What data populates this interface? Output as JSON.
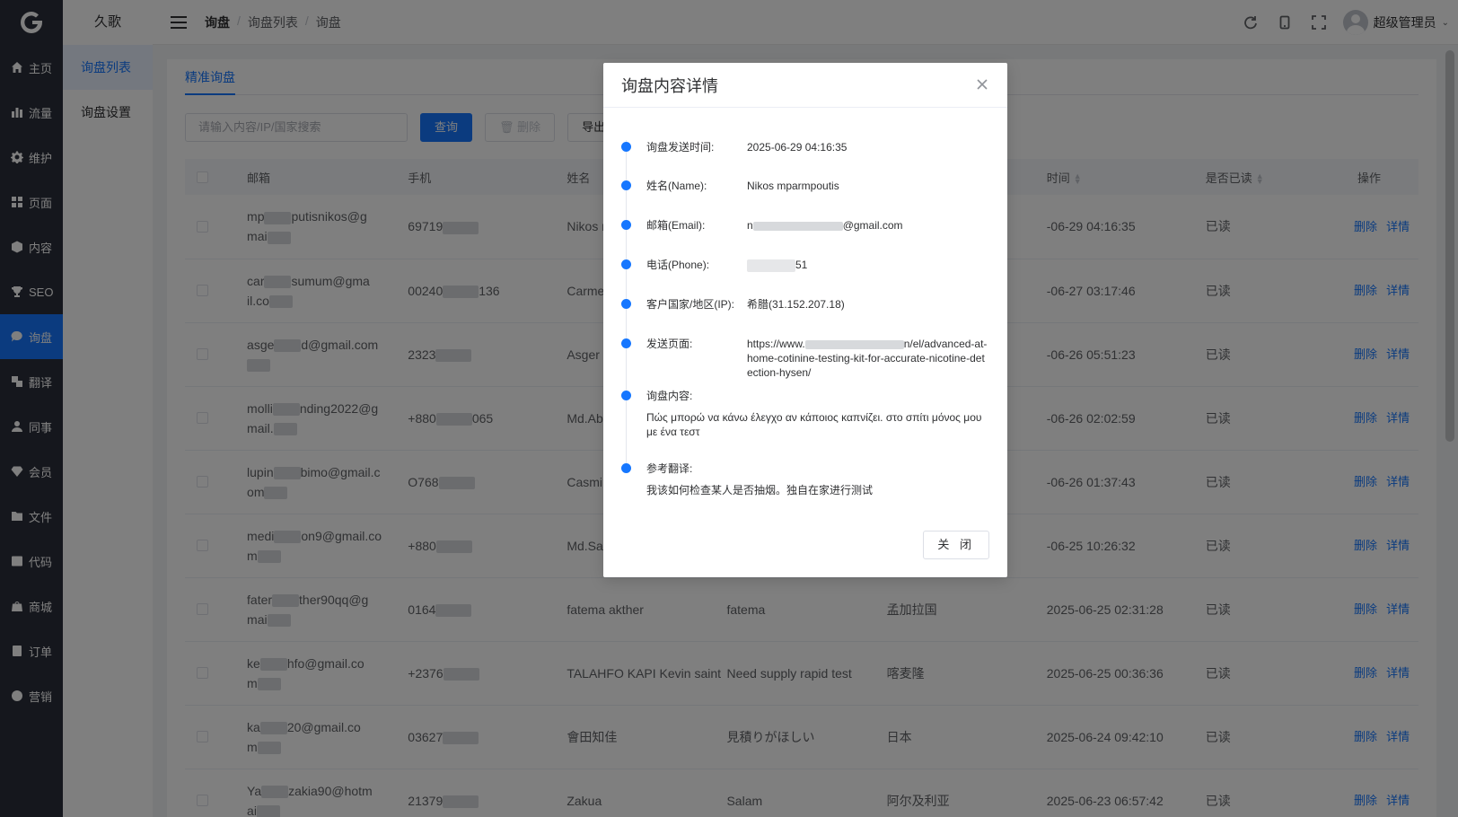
{
  "brand": {
    "logo_icon": "g-logo-icon",
    "app_name": "久歌"
  },
  "nav": [
    {
      "label": "主页",
      "icon": "home-icon"
    },
    {
      "label": "流量",
      "icon": "bar-chart-icon"
    },
    {
      "label": "维护",
      "icon": "gear-icon"
    },
    {
      "label": "页面",
      "icon": "grid-icon"
    },
    {
      "label": "内容",
      "icon": "cube-icon"
    },
    {
      "label": "SEO",
      "icon": "trophy-icon"
    },
    {
      "label": "询盘",
      "icon": "chat-icon",
      "active": true
    },
    {
      "label": "翻译",
      "icon": "translate-icon"
    },
    {
      "label": "同事",
      "icon": "user-icon"
    },
    {
      "label": "会员",
      "icon": "diamond-icon"
    },
    {
      "label": "文件",
      "icon": "folder-icon"
    },
    {
      "label": "代码",
      "icon": "code-icon"
    },
    {
      "label": "商城",
      "icon": "bag-icon"
    },
    {
      "label": "订单",
      "icon": "order-icon"
    },
    {
      "label": "营销",
      "icon": "snowflake-icon"
    }
  ],
  "subnav": {
    "items": [
      "询盘列表",
      "询盘设置"
    ],
    "active": 0
  },
  "header": {
    "breadcrumb": [
      "询盘",
      "询盘列表",
      "询盘"
    ],
    "separator": "/",
    "icons": [
      "refresh-icon",
      "mobile-icon",
      "fullscreen-icon"
    ],
    "user": "超级管理员"
  },
  "tabs": [
    "精准询盘"
  ],
  "toolbar": {
    "search_placeholder": "请输入内容/IP/国家搜索",
    "query": "查询",
    "delete": "删除",
    "export": "导出"
  },
  "table": {
    "columns": [
      "邮箱",
      "手机",
      "姓名",
      "",
      "",
      "时间",
      "是否已读",
      "操作"
    ],
    "rows": [
      {
        "email1": "mp",
        "email2": "putisnikos@g",
        "email3": "mai",
        "phone_a": "69719",
        "phone_b": "",
        "name": "Nikos mpar",
        "subject": "",
        "country": "",
        "time": "-06-29 04:16:35",
        "read": "已读"
      },
      {
        "email1": "car",
        "email2": "sumum@gma",
        "email3": "il.co",
        "phone_a": "00240",
        "phone_b": "136",
        "name": "Carmelo as seng",
        "subject": "",
        "country": "",
        "time": "-06-27 03:17:46",
        "read": "已读"
      },
      {
        "email1": "asge",
        "email2": "d@gmail.com",
        "email3": "",
        "phone_a": "2323",
        "phone_b": "",
        "name": "Asger Kyed",
        "subject": "",
        "country": "",
        "time": "-06-26 05:51:23",
        "read": "已读"
      },
      {
        "email1": "molli",
        "email2": "nding2022@g",
        "email3": "mail.",
        "phone_a": "+880",
        "phone_b": "065",
        "name": "Md.Abdul H",
        "subject": "",
        "country": "",
        "time": "-06-26 02:02:59",
        "read": "已读"
      },
      {
        "email1": "lupin",
        "email2": "bimo@gmail.c",
        "email3": "om",
        "phone_a": "O768",
        "phone_b": "",
        "name": "Casmiry lup",
        "subject": "",
        "country": "",
        "time": "-06-26 01:37:43",
        "read": "已读"
      },
      {
        "email1": "medi",
        "email2": "on9@gmail.co",
        "email3": "m",
        "phone_a": "+880",
        "phone_b": "",
        "name": "Md.Saiful Is",
        "subject": "",
        "country": "",
        "time": "-06-25 10:26:32",
        "read": "已读"
      },
      {
        "email1": "fater",
        "email2": "ther90qq@g",
        "email3": "mai",
        "phone_a": "0164",
        "phone_b": "",
        "name": "fatema akther",
        "subject": "fatema",
        "country": "孟加拉国",
        "time": "2025-06-25 02:31:28",
        "read": "已读"
      },
      {
        "email1": "ke",
        "email2": "hfo@gmail.co",
        "email3": "m",
        "phone_a": "+2376",
        "phone_b": "",
        "name": "TALAHFO KAPI Kevin saint",
        "subject": "Need supply rapid test",
        "country": "喀麦隆",
        "time": "2025-06-25 00:36:36",
        "read": "已读"
      },
      {
        "email1": "ka",
        "email2": "20@gmail.co",
        "email3": "m",
        "phone_a": "03627",
        "phone_b": "",
        "name": "會田知佳",
        "subject": "見積りがほしい",
        "country": "日本",
        "time": "2025-06-24 09:42:10",
        "read": "已读"
      },
      {
        "email1": "Ya",
        "email2": "zakia90@hotm",
        "email3": "ai",
        "phone_a": "21379",
        "phone_b": "",
        "name": "Zakua",
        "subject": "Salam",
        "country": "阿尔及利亚",
        "time": "2025-06-23 06:57:42",
        "read": "已读"
      }
    ],
    "op_delete": "删除",
    "op_detail": "详情"
  },
  "dialog": {
    "title": "询盘内容详情",
    "items": [
      {
        "label": "询盘发送时间:",
        "value": "2025-06-29 04:16:35"
      },
      {
        "label": "姓名(Name):",
        "value": "Nikos mparmpoutis"
      },
      {
        "label": "邮箱(Email):",
        "value_prefix": "n",
        "value": "@gmail.com"
      },
      {
        "label": "电话(Phone):",
        "value": "51"
      },
      {
        "label": "客户国家/地区(IP):",
        "value": "希腊(31.152.207.18)"
      },
      {
        "label": "发送页面:",
        "value_prefix": "https://www.",
        "value": "n/el/advanced-at-home-cotinine-testing-kit-for-accurate-nicotine-detection-hysen/"
      },
      {
        "label": "询盘内容:",
        "value": "Πώς μπορώ να κάνω έλεγχο αν κάποιος καπνίζει. στο σπίτι μόνος μου με ένα τεστ"
      },
      {
        "label": "参考翻译:",
        "value": "我该如何检查某人是否抽烟。独自在家进行测试"
      }
    ],
    "close_button": "关 闭"
  },
  "colors": {
    "primary": "#1677ff",
    "sidebar": "#2b2f3a",
    "mask": "rgba(0,0,0,0.5)"
  }
}
